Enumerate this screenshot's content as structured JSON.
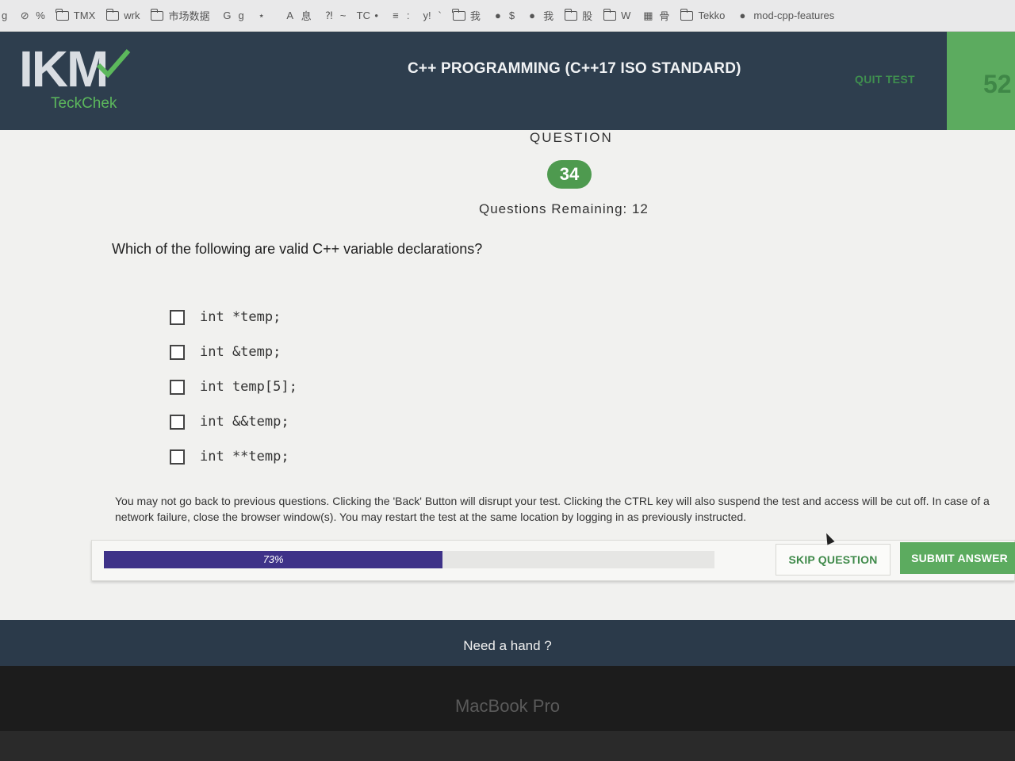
{
  "bookmarks": [
    {
      "icon": "bookmark-icon",
      "glyph": "",
      "label": "g"
    },
    {
      "icon": "block-icon",
      "glyph": "⊘",
      "label": "%"
    },
    {
      "icon": "folder-icon",
      "glyph": "folder",
      "label": "TMX"
    },
    {
      "icon": "folder-icon",
      "glyph": "folder",
      "label": "wrk"
    },
    {
      "icon": "folder-icon",
      "glyph": "folder",
      "label": "市场数据"
    },
    {
      "icon": "google-icon",
      "glyph": "G",
      "label": "g"
    },
    {
      "icon": "site-icon",
      "glyph": "⋆",
      "label": ""
    },
    {
      "icon": "site-icon",
      "glyph": "A",
      "label": "息"
    },
    {
      "icon": "site-icon",
      "glyph": "⁈",
      "label": "~"
    },
    {
      "icon": "site-icon",
      "glyph": "TC",
      "label": "•"
    },
    {
      "icon": "site-icon",
      "glyph": "≡",
      "label": ":"
    },
    {
      "icon": "yahoo-icon",
      "glyph": "y!",
      "label": "`"
    },
    {
      "icon": "folder-icon",
      "glyph": "folder",
      "label": "我"
    },
    {
      "icon": "globe-icon",
      "glyph": "●",
      "label": "$"
    },
    {
      "icon": "globe-icon",
      "glyph": "●",
      "label": "我"
    },
    {
      "icon": "folder-icon",
      "glyph": "folder",
      "label": "股"
    },
    {
      "icon": "folder-icon",
      "glyph": "folder",
      "label": "W"
    },
    {
      "icon": "grid-icon",
      "glyph": "▦",
      "label": "骨"
    },
    {
      "icon": "folder-icon",
      "glyph": "folder",
      "label": "Tekko"
    },
    {
      "icon": "github-icon",
      "glyph": "●",
      "label": "mod-cpp-features"
    }
  ],
  "header": {
    "logo_main": "IKM",
    "logo_sub": "TeckChek",
    "test_title": "C++ PROGRAMMING (C++17 ISO STANDARD)",
    "quit_label": "QUIT TEST",
    "timer": "52"
  },
  "question": {
    "label": "QUESTION",
    "number": "34",
    "remaining": "Questions Remaining: 12",
    "text": "Which of the following are valid C++ variable declarations?",
    "options": [
      {
        "code": "int *temp;",
        "checked": false
      },
      {
        "code": "int &temp;",
        "checked": false
      },
      {
        "code": "int temp[5];",
        "checked": false
      },
      {
        "code": "int &&temp;",
        "checked": false
      },
      {
        "code": "int **temp;",
        "checked": false
      }
    ]
  },
  "notice": "You may not go back to previous questions. Clicking the 'Back' Button will disrupt your test. Clicking the CTRL key will also suspend the test and access will be cut off. In case of a network failure, close the browser window(s). You may restart the test at the same location by logging in as previously instructed.",
  "progress": {
    "percent": 73,
    "label": "73%"
  },
  "buttons": {
    "skip": "SKIP QUESTION",
    "submit": "SUBMIT ANSWER"
  },
  "footer": {
    "help": "Need a hand ?"
  },
  "device": {
    "label": "MacBook Pro"
  },
  "colors": {
    "header": "#2e3e4e",
    "accent_green": "#5cab5f",
    "progress": "#3e3288"
  }
}
